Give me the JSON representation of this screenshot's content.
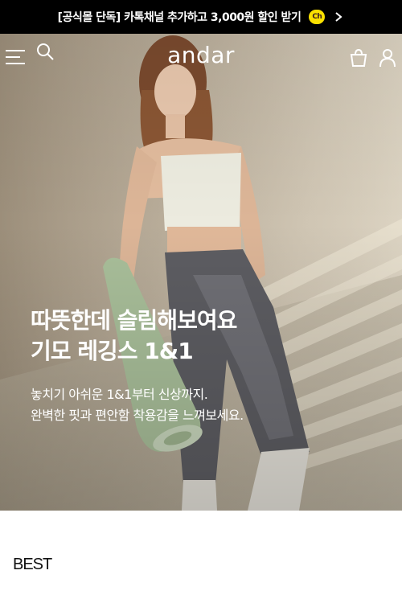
{
  "promo_banner": {
    "text": "[공식몰 단독] 카톡채널 추가하고 3,000원 할인 받기",
    "badge": "Ch",
    "badge_color": "#fae100"
  },
  "header": {
    "logo": "andar",
    "icons": [
      "menu-icon",
      "search-icon",
      "shopping-bag-icon",
      "user-icon"
    ]
  },
  "hero": {
    "title_line1": "따뜻한데 슬림해보여요",
    "title_line2": "기모 레깅스 1&1",
    "subtitle_line1": "놓치기 아쉬운 1&1부터 신상까지.",
    "subtitle_line2": "완벽한 핏과 편안함 착용감을 느껴보세요."
  },
  "best": {
    "title": "BEST"
  }
}
